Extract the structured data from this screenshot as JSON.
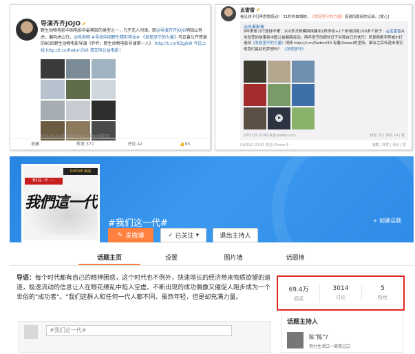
{
  "post_a": {
    "author": "导演齐齐JOJO",
    "text_1": "野生动物电影中国电影中最稀缺的类型之一，几乎无人问津。而",
    "text_2": "@导演齐齐JOJO",
    "text_3": "明知山有虎，偏向虎山行。",
    "text_4": "@风景网 #寻找中国野生精彩样本# 《发现坚守的力量》",
    "text_5": "马云曾公开感谢的80后野生动物电影导演《乔乔：野生动物电影导演第一人》",
    "text_6": "http://t.cn/RZgjkW 今日上线 http://t.cn/Rwbm306 请支持公益电影！",
    "time": "5月31日 22:08 来自 iPhone 6 Plus(深空灰)",
    "actions": [
      "收藏",
      "转发 377",
      "评论 42",
      "95"
    ],
    "photo_colors": [
      "#3a3a3a",
      "#7c8c96",
      "#9fb3c0",
      "#b6c3cf",
      "#5f6d4c",
      "#cfd6dc",
      "#a6aeb4",
      "#c7cdd2",
      "#2e2e2e",
      "#6b5b43",
      "#8c7a5c",
      "#4a4a4a"
    ]
  },
  "post_b": {
    "author": "孟雷雷",
    "text_1": "看见孩子们再思想感动！ 21秒热血相映…",
    "text_2": "《发现坚守的力量》",
    "text_3": "感谢风景网的记录。[爱心]",
    "repost_author": "@风景影像",
    "repost_text_1": "8年来体力行坚持不懈：100多万新模网络建出1所学校+1个体域训练100多个孩子：",
    "repost_text_2": "@孟雷雷",
    "repost_text_3": "从体验营的故事到中国公益健康运动",
    "repost_text_4": "。两年坚守的那些日子对我自己的快乐！风景网携手萨威尔打造特",
    "repost_text_5": "《发现坚守的力量》",
    "repost_text_6": "视频 http://t.cn/Rwbmi30 有着Gtowei的坚持、聚合之后传递未来实现我们最初的梦想吗？",
    "repost_link": "《发现坚守》",
    "repost_time": "5月31日 20:40 来自 weibo.com",
    "repost_counts": "转发 25 | 评论 14 | 赞",
    "time": "5月31日 23:55 来自 iPhone 6",
    "actions": "收藏 | 转发 | 评论 | 赞",
    "photo_colors": [
      "#3d3a2f",
      "#b4a78f",
      "#6f8fb0",
      "#a32d2d",
      "#7a9a68",
      "#3f6fa8",
      "#5b5046",
      "#2d3340",
      "#89b36a"
    ]
  },
  "topic": {
    "cover_badge": "我们这一代 ——",
    "cover_logo": "ROEWE 荣威",
    "cover_title": "我們這一代",
    "title": "#我们这一代#",
    "create_label": "+ 创建话题",
    "post_button": "发微博",
    "follow_button": "已关注",
    "quit_button": "退出主持人",
    "tabs": [
      "话题主页",
      "设置",
      "图片墙",
      "话题榜"
    ],
    "intro_lead": "导语：",
    "intro_text": "每个时代都有自己的精神困惑，这个时代也不例外，快速增长的经济带来物质欲望的追逐，极速流动的信息让人在眼花缭乱中陷入空虚。不断出现的成功偶像又催促人跑步成为一个世俗的\"成功者\"。\"我们这群人和任何一代人都不同，虽然年轻，但是却充满力量。",
    "compose_placeholder": "#我们这一代#",
    "stats": [
      {
        "value": "69.4万",
        "label": "阅读"
      },
      {
        "value": "3014",
        "label": "讨论"
      },
      {
        "value": "5",
        "label": "粉丝"
      }
    ],
    "host_title": "话题主持人",
    "host_name": "陈\"陈\"?",
    "host_motto": "努力生活口一笑而过口",
    "stats_highlight_color": "#e1261c",
    "accent_color": "#ff8140"
  }
}
